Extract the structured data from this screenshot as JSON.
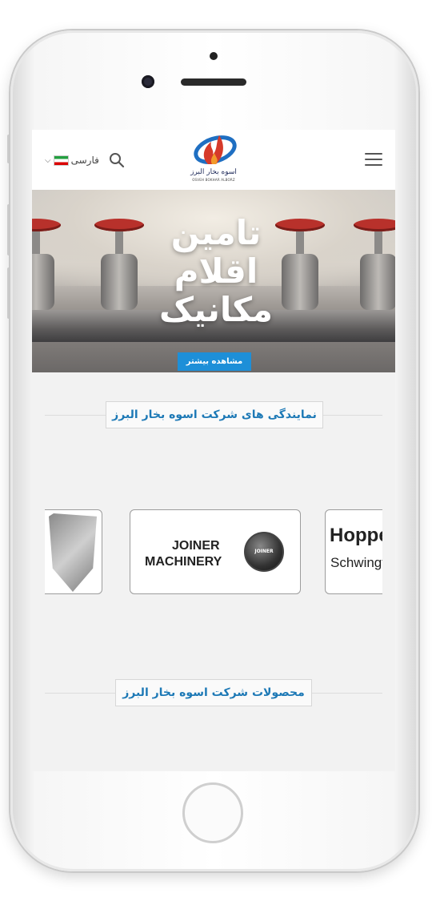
{
  "header": {
    "language_label": "فارسی",
    "logo_title": "اسوه بخار البرز",
    "logo_subtitle": "OSVEH BOKHAR ALBORZ"
  },
  "hero": {
    "title_line1": "تامین",
    "title_line2": "اقلام",
    "title_line3": "مکانیک",
    "button_label": "مشاهده بیشتر"
  },
  "sections": {
    "representations_title": "نمایندگی های شرکت اسوه بخار البرز",
    "products_title": "محصولات شرکت اسوه بخار البرز"
  },
  "brands": [
    {
      "name": "shield-brand"
    },
    {
      "name": "joiner",
      "line1": "JOINER",
      "line2": "MACHINERY",
      "badge": "JOINER"
    },
    {
      "name": "hoppe",
      "line1": "Hoppe",
      "line2": "Schwingt"
    }
  ],
  "colors": {
    "accent": "#1d79b6",
    "button": "#1d8fd8",
    "valve_red": "#b8312b"
  }
}
